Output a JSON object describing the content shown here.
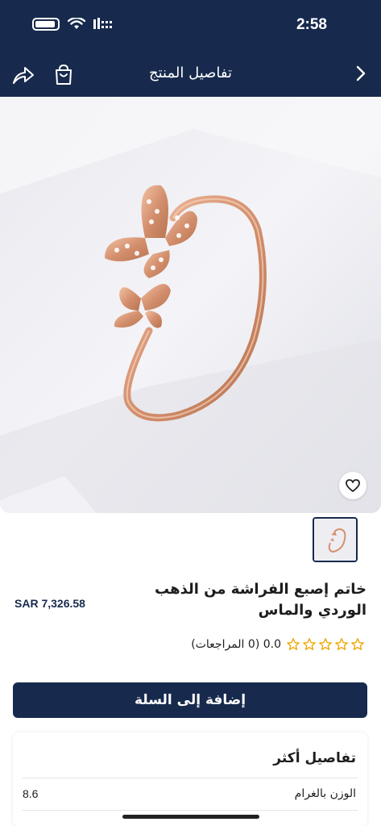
{
  "status_bar": {
    "time": "2:58"
  },
  "navbar": {
    "title": "تفاصيل المنتج",
    "back_icon": "chevron-right-icon",
    "cart_icon": "shopping-bag-icon",
    "share_icon": "share-icon"
  },
  "product": {
    "title": "خاتم إصبع الفراشة من الذهب الوردي والماس",
    "price": "SAR 7,326.58",
    "rating_text": "0.0 (0 المراجعات)",
    "rating_value": 0,
    "max_stars": 5
  },
  "actions": {
    "add_to_cart": "إضافة إلى السلة"
  },
  "details": {
    "title": "تفاصيل أكثر",
    "specs": [
      {
        "label": "الوزن بالغرام",
        "value": "8.6"
      }
    ]
  },
  "colors": {
    "primary": "#172a4d",
    "star": "#f0a500",
    "metal": "#d79a7a"
  }
}
